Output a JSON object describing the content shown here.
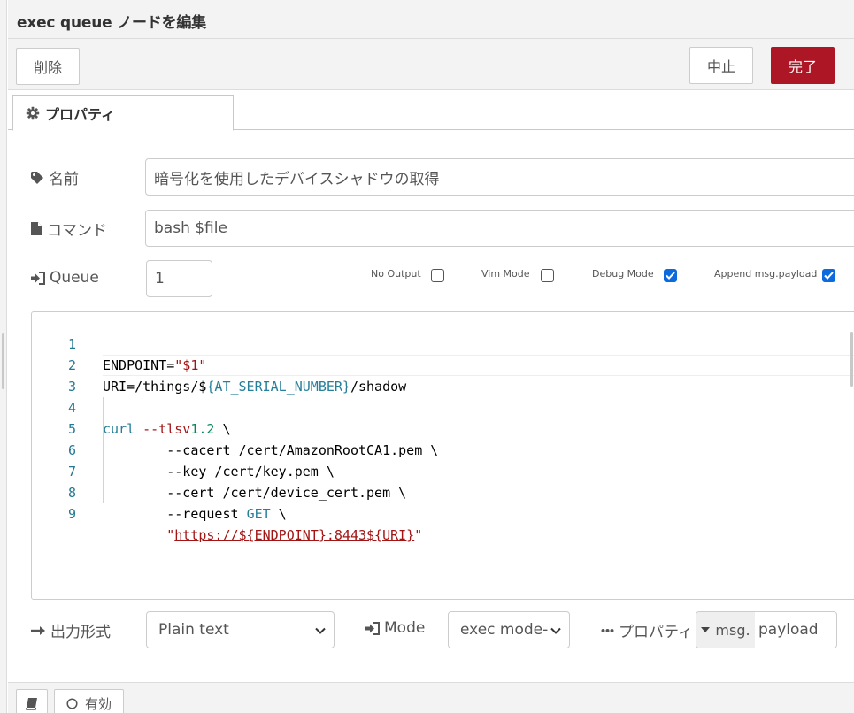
{
  "header": {
    "title": "exec queue ノードを編集"
  },
  "toolbar": {
    "delete_label": "削除",
    "cancel_label": "中止",
    "done_label": "完了"
  },
  "tabs": [
    {
      "label": "プロパティ",
      "icon": "gear-icon"
    }
  ],
  "form": {
    "name_label": "名前",
    "name_value": "暗号化を使用したデバイスシャドウの取得",
    "command_label": "コマンド",
    "command_value": "bash $file",
    "queue_label": "Queue",
    "queue_value": "1",
    "options": [
      {
        "label": "No Output",
        "checked": false
      },
      {
        "label": "Vim Mode",
        "checked": false
      },
      {
        "label": "Debug Mode",
        "checked": true
      },
      {
        "label": "Append msg.payload",
        "checked": true
      }
    ]
  },
  "editor": {
    "line_numbers": [
      "1",
      "2",
      "3",
      "4",
      "5",
      "6",
      "7",
      "8",
      "9"
    ],
    "l1": {
      "a": "ENDPOINT=",
      "b": "\"$1\""
    },
    "l2": {
      "a": "URI=/things/$",
      "b": "{AT_SERIAL_NUMBER}",
      "c": "/shadow"
    },
    "l4": {
      "a": "curl",
      "b": " --tlsv",
      "c": "1.2",
      "d": " \\"
    },
    "l5": "        --cacert /cert/AmazonRootCA1.pem \\",
    "l6": "        --key /cert/key.pem \\",
    "l7": "        --cert /cert/device_cert.pem \\",
    "l8": {
      "a": "        --request ",
      "b": "GET",
      "c": " \\"
    },
    "l9": {
      "a": "        \"",
      "b": "https://${ENDPOINT}:8443${URI}",
      "c": "\""
    }
  },
  "bottom": {
    "output_label": "出力形式",
    "output_value": "Plain text",
    "mode_label": "Mode",
    "mode_value": "exec mode-",
    "property_label": "プロパティ",
    "property_type": "msg.",
    "property_value": "payload"
  },
  "footer": {
    "enabled_label": "有効"
  },
  "colors": {
    "accent": "#ad1625",
    "checkbox": "#0b6bde"
  }
}
